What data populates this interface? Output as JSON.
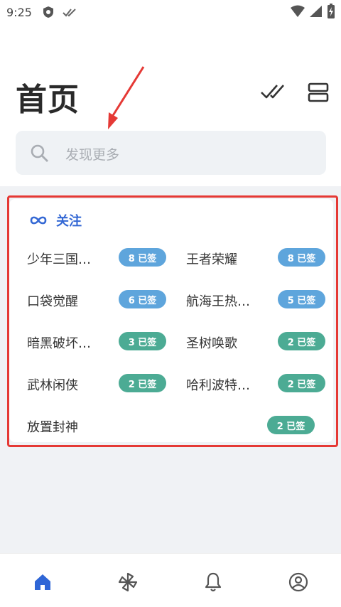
{
  "status_bar": {
    "time": "9:25"
  },
  "header": {
    "title": "首页"
  },
  "search": {
    "placeholder": "发现更多"
  },
  "follow": {
    "title": "关注",
    "items": [
      {
        "name": "少年三国…",
        "badge": "8 已签",
        "color": "#5ea5dc"
      },
      {
        "name": "王者荣耀",
        "badge": "8 已签",
        "color": "#5ea5dc"
      },
      {
        "name": "口袋觉醒",
        "badge": "6 已签",
        "color": "#5ea5dc"
      },
      {
        "name": "航海王热…",
        "badge": "5 已签",
        "color": "#5ea5dc"
      },
      {
        "name": "暗黑破坏…",
        "badge": "3 已签",
        "color": "#4cab94"
      },
      {
        "name": "圣树唤歌",
        "badge": "2 已签",
        "color": "#4cab94"
      },
      {
        "name": "武林闲侠",
        "badge": "2 已签",
        "color": "#4cab94"
      },
      {
        "name": "哈利波特…",
        "badge": "2 已签",
        "color": "#4cab94"
      },
      {
        "name": "放置封神",
        "badge": "2 已签",
        "color": "#4cab94"
      }
    ]
  },
  "colors": {
    "accent": "#3468d4",
    "highlight": "#e53935",
    "nav_active": "#2f66d6",
    "nav_inactive": "#555555"
  },
  "bottom_nav": [
    {
      "icon": "home-icon",
      "active": true
    },
    {
      "icon": "pinwheel-icon",
      "active": false
    },
    {
      "icon": "bell-icon",
      "active": false
    },
    {
      "icon": "profile-icon",
      "active": false
    }
  ]
}
